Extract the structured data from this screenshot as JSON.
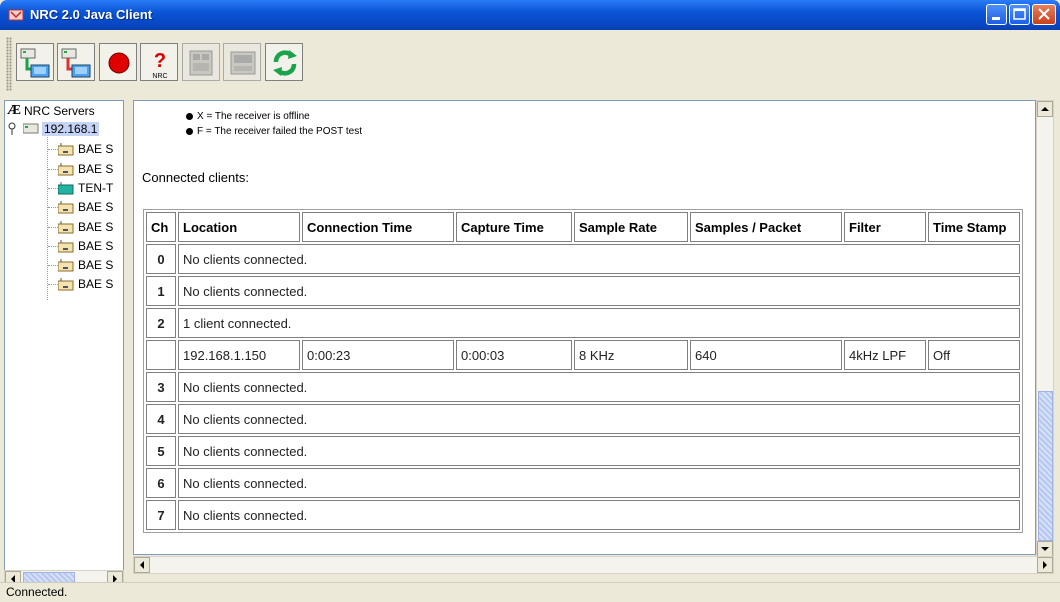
{
  "window": {
    "title": "NRC 2.0 Java Client"
  },
  "toolbar": {
    "buttons": [
      {
        "name": "connect-server",
        "icon": "server-connect-icon"
      },
      {
        "name": "disconnect-server",
        "icon": "server-disconnect-icon"
      },
      {
        "name": "record",
        "icon": "record-icon"
      },
      {
        "name": "help",
        "icon": "help-icon",
        "label": "NRC"
      },
      {
        "name": "disabled-1",
        "icon": "panel-icon"
      },
      {
        "name": "disabled-2",
        "icon": "device-icon"
      },
      {
        "name": "refresh",
        "icon": "refresh-icon"
      }
    ],
    "help_label": "NRC"
  },
  "tree": {
    "root_label": "NRC Servers",
    "root_logo": "Æ",
    "server_label": "192.168.1",
    "children": [
      "BAE S",
      "BAE S",
      "TEN-T",
      "BAE S",
      "BAE S",
      "BAE S",
      "BAE S",
      "BAE S"
    ]
  },
  "legend": {
    "line_x": "X = The receiver is offline",
    "line_f": "F = The receiver failed the POST test"
  },
  "clients": {
    "section_title": "Connected clients:",
    "headers": [
      "Ch",
      "Location",
      "Connection Time",
      "Capture Time",
      "Sample Rate",
      "Samples / Packet",
      "Filter",
      "Time Stamp"
    ],
    "rows": [
      {
        "ch": "0",
        "text": "No clients connected."
      },
      {
        "ch": "1",
        "text": "No clients connected."
      },
      {
        "ch": "2",
        "text": "1 client connected."
      },
      {
        "ch": "",
        "location": "192.168.1.150",
        "connection_time": "0:00:23",
        "capture_time": "0:00:03",
        "sample_rate": "8 KHz",
        "samples_packet": "640",
        "filter": "4kHz LPF",
        "time_stamp": "Off"
      },
      {
        "ch": "3",
        "text": "No clients connected."
      },
      {
        "ch": "4",
        "text": "No clients connected."
      },
      {
        "ch": "5",
        "text": "No clients connected."
      },
      {
        "ch": "6",
        "text": "No clients connected."
      },
      {
        "ch": "7",
        "text": "No clients connected."
      }
    ]
  },
  "status": {
    "text": "Connected."
  },
  "colors": {
    "titlebar": "#0a55d6",
    "record": "#e00000",
    "refresh": "#1aa34a",
    "tree_selection": "#c5d3f6"
  }
}
